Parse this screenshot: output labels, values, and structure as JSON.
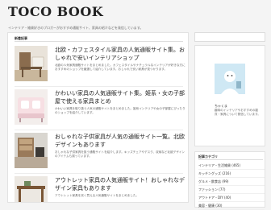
{
  "site": {
    "title": "TOCO BOOK",
    "tagline": "インテリア・雑貨好きのブロガーがおすすめ通販サイト、家具の紹介などを発信しています。"
  },
  "main": {
    "section_label": "新着記事",
    "articles": [
      {
        "title": "北欧・カフェスタイル家具の人気通販サイト集。おしゃれで安いインテリアショップ",
        "excerpt": "北欧の人気家具通販サイトをまとめました。カフェスタイルやナチュラルなインテリアが好きな方におすすめのショップを厳選して紹介しています。おしゃれで安い家具が見つかります。"
      },
      {
        "title": "かわいい家具の人気通販サイト集。姫系・女の子部屋で使える家具まとめ",
        "excerpt": "かわいい家具を取り扱う人気の通販サイトをまとめました。姫系インテリアや女の子部屋にぴったりのショップを紹介しています。"
      },
      {
        "title": "おしゃれな子供家具が人気の通販サイト一覧。北欧デザインもあります",
        "excerpt": "おしゃれな子供家具を扱う通販サイトを紹介します。キッズチェアやデスク、収納など北欧デザインのアイテムも揃っています。"
      },
      {
        "title": "アウトレット家具の人気通販サイト！おしゃれなデザイン家具もあります",
        "excerpt": "アウトレット家具を安く買える人気通販サイトをまとめました。"
      }
    ]
  },
  "sidebar": {
    "author": "ちゃくま",
    "bio": "趣味のインテリアやおすすめの雑貨・家具について発信しています。",
    "categories_title": "記事カテゴリ",
    "categories": [
      "インテリア・生活雑貨 (465)",
      "キッチングッズ (216)",
      "グルメ・飲食店 (99)",
      "ファッション (77)",
      "アウトドア・DIY (40)",
      "美容・健康 (30)"
    ]
  }
}
